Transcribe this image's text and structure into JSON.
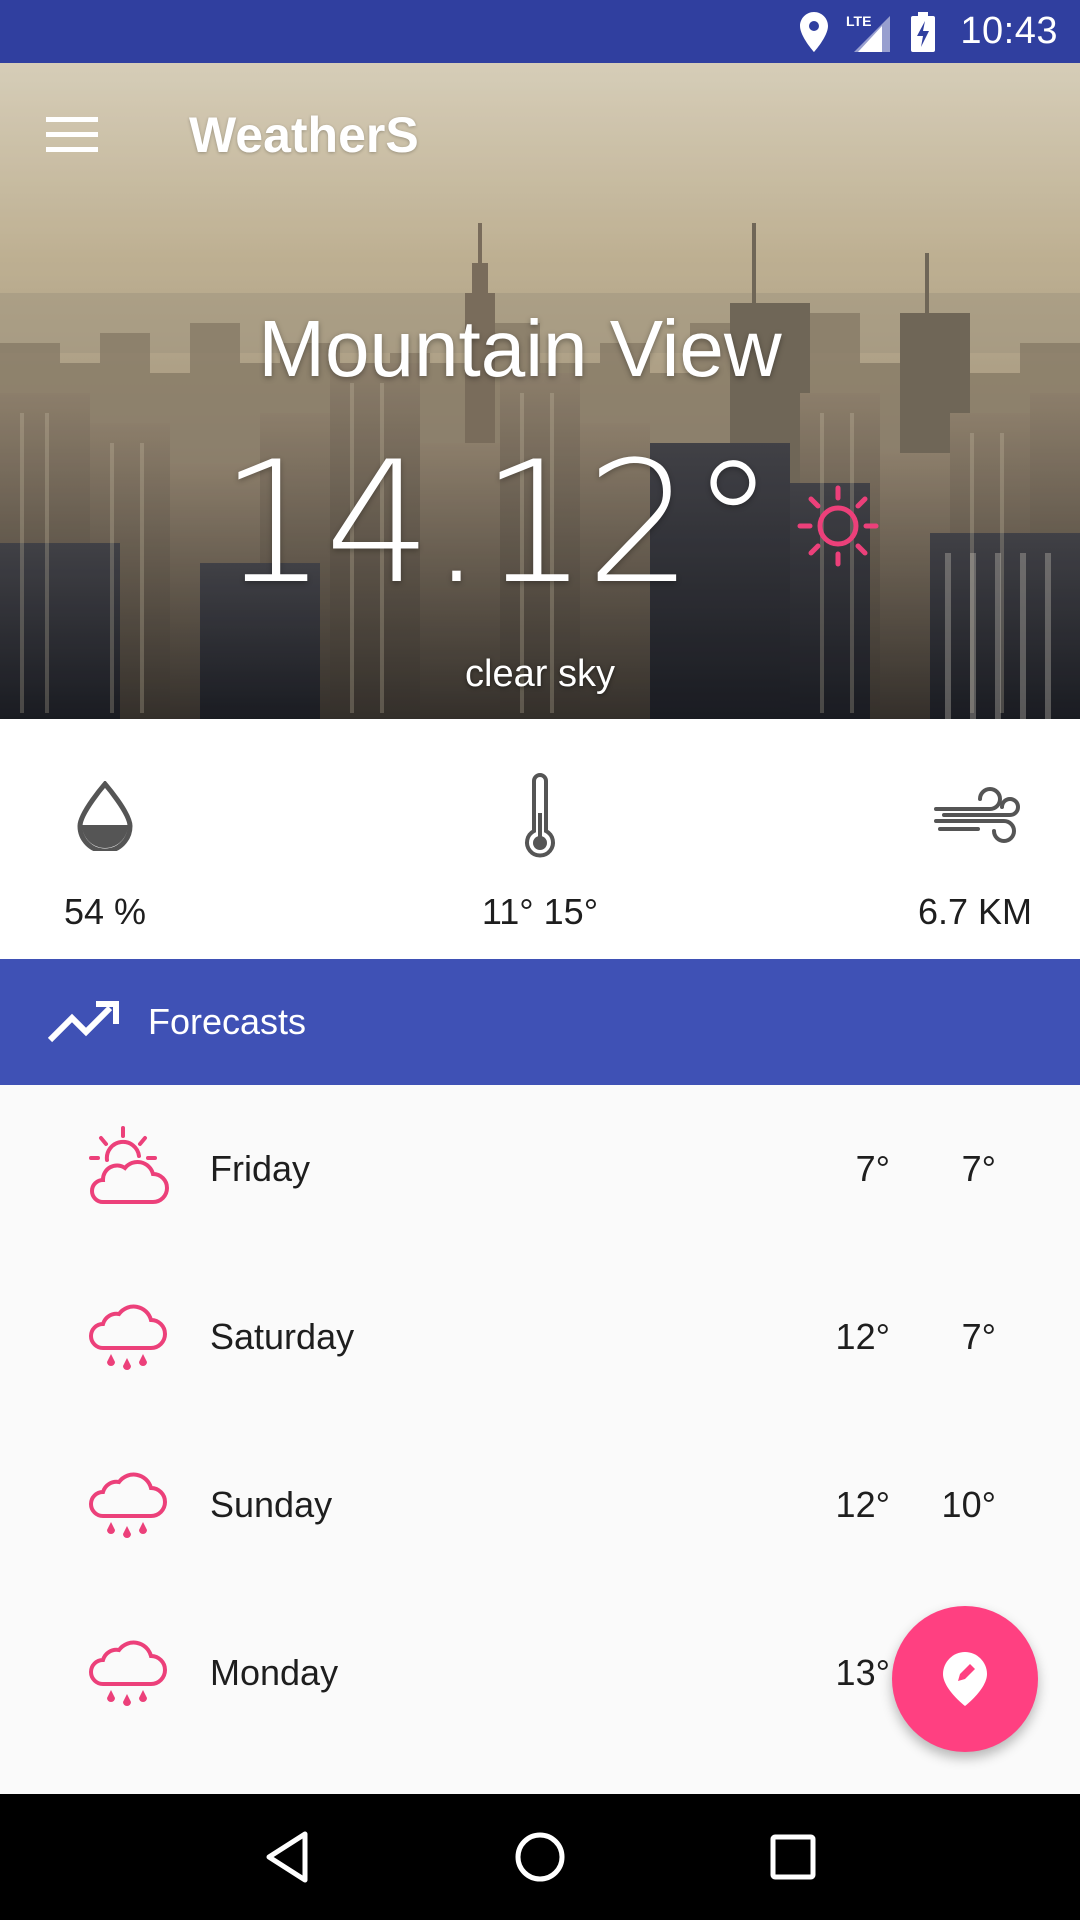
{
  "status_bar": {
    "time": "10:43",
    "network_label": "LTE",
    "icons": [
      "location-icon",
      "signal-icon",
      "battery-charging-icon"
    ]
  },
  "toolbar": {
    "title": "WeatherS",
    "menu_icon": "menu-icon"
  },
  "current": {
    "city": "Mountain View",
    "temperature": "14.12°",
    "condition": "clear sky",
    "condition_icon": "sun-icon"
  },
  "details": {
    "humidity": {
      "icon": "humidity-drop-icon",
      "value": "54 %"
    },
    "min_max": {
      "icon": "thermometer-icon",
      "value": "11° 15°"
    },
    "wind": {
      "icon": "wind-icon",
      "value": "6.7 KM"
    }
  },
  "forecast": {
    "header_label": "Forecasts",
    "header_icon": "trending-up-icon",
    "days": [
      {
        "day": "Friday",
        "max": "7°",
        "min": "7°",
        "icon": "partly-cloudy-icon"
      },
      {
        "day": "Saturday",
        "max": "12°",
        "min": "7°",
        "icon": "rain-cloud-icon"
      },
      {
        "day": "Sunday",
        "max": "12°",
        "min": "10°",
        "icon": "rain-cloud-icon"
      },
      {
        "day": "Monday",
        "max": "13°",
        "min": "",
        "icon": "rain-cloud-icon"
      }
    ]
  },
  "fab": {
    "icon": "edit-location-icon"
  },
  "nav_bar": {
    "icons": [
      "back-icon",
      "home-icon",
      "recents-icon"
    ]
  },
  "colors": {
    "primary_dark": "#303f9f",
    "primary": "#3f51b5",
    "accent": "#ff4081",
    "icon_pink": "#ec407a"
  }
}
